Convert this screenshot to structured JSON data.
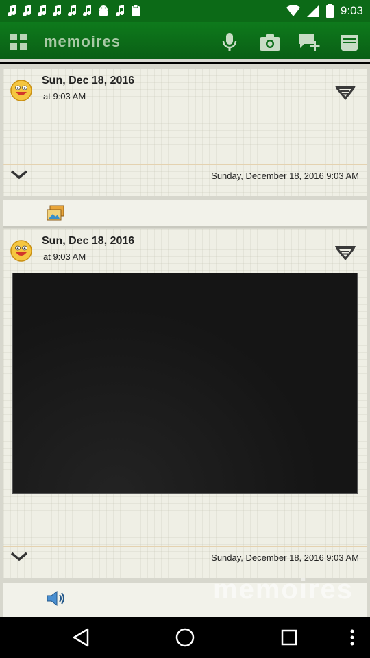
{
  "status_bar": {
    "time": "9:03",
    "left_icons": [
      "music-note-icon",
      "music-note-icon",
      "music-note-icon",
      "music-note-icon",
      "music-note-icon",
      "music-note-icon",
      "android-icon",
      "music-note-icon",
      "clipboard-icon"
    ],
    "right_icons": [
      "wifi-icon",
      "signal-icon",
      "battery-icon"
    ]
  },
  "app_bar": {
    "title": "memoires",
    "actions": [
      "microphone-icon",
      "camera-icon",
      "add-comment-icon",
      "menu-icon"
    ]
  },
  "entries": [
    {
      "date": "Sun, Dec 18, 2016",
      "time": "at 9:03 AM",
      "footer": "Sunday, December 18, 2016 9:03 AM"
    },
    {
      "date": "Sun, Dec 18, 2016",
      "time": "at 9:03 AM",
      "footer": "Sunday, December 18, 2016 9:03 AM"
    }
  ],
  "watermark": "memoires",
  "colors": {
    "app_bar": "#0e7a1c",
    "status_bar": "#0c6a17",
    "paper": "#efefe5"
  }
}
